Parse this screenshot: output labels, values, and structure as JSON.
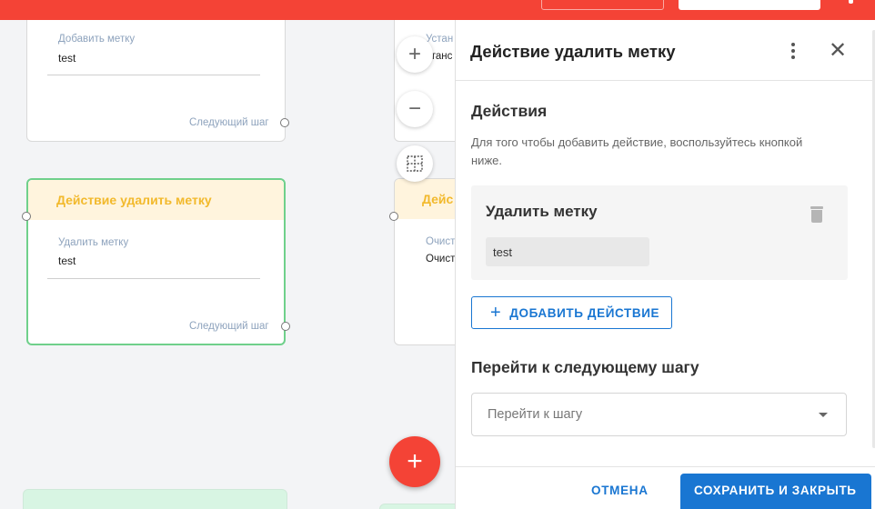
{
  "canvas": {
    "card1": {
      "field_label": "Добавить метку",
      "field_value": "test",
      "next_step": "Следующий шаг"
    },
    "card2": {
      "header": "Действие удалить метку",
      "field_label": "Удалить метку",
      "field_value": "test",
      "next_step": "Следующий шаг"
    },
    "card3": {
      "field_label": "Устан",
      "field_value": "станс"
    },
    "card4": {
      "header": "Дейс",
      "field_label": "Очист",
      "field_value": "Очист"
    },
    "zoom": {
      "in_icon": "plus-icon",
      "out_icon": "minus-icon",
      "fit_icon": "fit-grid-icon"
    },
    "fab_icon": "plus-icon"
  },
  "panel": {
    "title": "Действие удалить метку",
    "menu_icon": "more-vertical-icon",
    "close_icon": "close-icon",
    "actions_title": "Действия",
    "actions_hint": "Для того чтобы добавить действие, воспользуйтесь кнопкой ниже.",
    "action_item": {
      "title": "Удалить метку",
      "chip": "test",
      "delete_icon": "trash-icon"
    },
    "add_action_label": "ДОБАВИТЬ ДЕЙСТВИЕ",
    "next_step_title": "Перейти к следующему шагу",
    "next_step_placeholder": "Перейти к шагу",
    "cancel_label": "ОТМЕНА",
    "save_label": "СОХРАНИТЬ И ЗАКРЫТЬ"
  },
  "colors": {
    "topbar": "#f44336",
    "primary": "#1976d2",
    "header_bg": "#fff4dd",
    "header_text": "#f2b92c",
    "selected_border": "#6fd08b",
    "green_card_bg": "#d8f5e3"
  }
}
